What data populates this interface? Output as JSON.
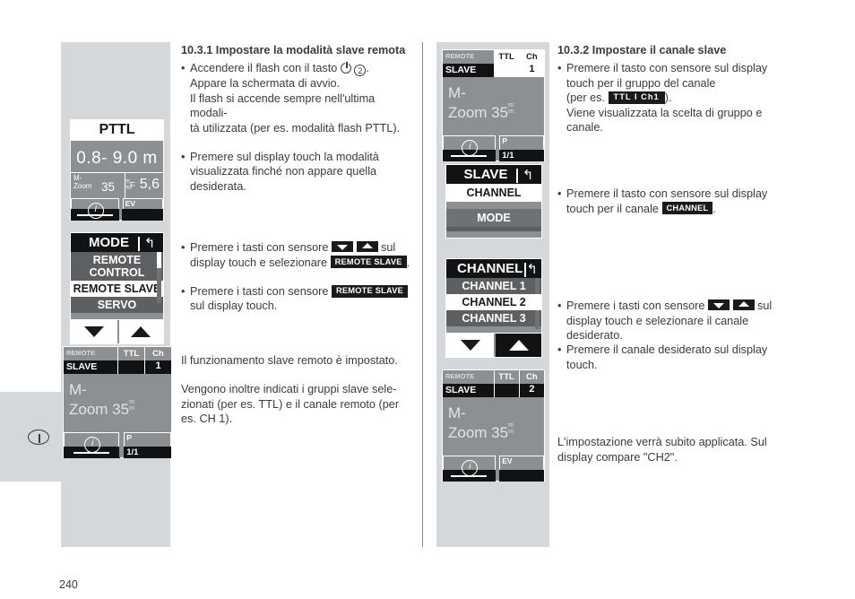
{
  "page": {
    "number": "240",
    "margin_icon": "info-oval-icon"
  },
  "left_column": {
    "heading": "10.3.1 Impostare la modalità slave remota",
    "bullets": [
      {
        "lines": [
          "Accendere il flash con il tasto  [power]  (2).",
          "Appare la schermata di avvio.",
          "Il flash si accende sempre nell'ultima modali-",
          "tà utilizzata (per es. modalità flash PTTL)."
        ]
      },
      {
        "lines": [
          "Premere sul display touch la modalità",
          "visualizzata finché non appare quella",
          "desiderata."
        ]
      },
      {
        "lines": [
          "Premere i tasti con sensore [down] [up] sul",
          "display touch e selezionare [REMOTE SLAVE] ."
        ]
      },
      {
        "lines": [
          "Premere i tasti con sensore [REMOTE SLAVE]",
          "sul display touch."
        ]
      }
    ],
    "paragraphs": [
      "Il funzionamento slave remoto è impostato.",
      "Vengono inoltre indicati i gruppi slave sele-",
      "zionati (per es. TTL) e il canale remoto (per",
      "es. CH 1)."
    ],
    "b1_l1a": "Accendere il flash con il tasto",
    "b1_l1b": ".",
    "b1_l2": "Appare la schermata di avvio.",
    "b1_l3": "Il flash si accende sempre nell'ultima modali-",
    "b1_l4": "tà utilizzata (per es. modalità flash PTTL).",
    "b2_l1": "Premere sul display touch la modalità",
    "b2_l2": "visualizzata finché non appare quella",
    "b2_l3": "desiderata.",
    "b3_l1a": "Premere i tasti con sensore",
    "b3_l1b": "sul",
    "b3_l2a": "display touch e selezionare",
    "b3_l2b": ".",
    "b4_l1a": "Premere i tasti con sensore",
    "b4_l2": "sul display touch.",
    "p1": "Il funzionamento slave remoto è impostato.",
    "p2_l1": "Vengono inoltre indicati i gruppi slave sele-",
    "p2_l2": "zionati (per es. TTL) e il canale remoto (per",
    "p2_l3": "es. CH 1).",
    "badge_remote_slave": "REMOTE SLAVE",
    "power_number": "2"
  },
  "right_column": {
    "heading": "10.3.2 Impostare il canale slave",
    "b1_l1": "Premere il tasto con sensore sul display",
    "b1_l2": "touch per il gruppo del canale",
    "b1_l3a": "(per es.",
    "b1_l3b": ").",
    "b1_l4": "Viene visualizzata la scelta di gruppo e",
    "b1_l5": "canale.",
    "b2_l1": "Premere il tasto con sensore sul display",
    "b2_l2a": "touch per il canale",
    "b2_l2b": ".",
    "b3_l1a": "Premere i tasti con sensore",
    "b3_l1b": "sul",
    "b3_l2": "display touch e selezionare il canale",
    "b3_l3": "desiderato.",
    "b4_l1": "Premere il canale desiderato sul display",
    "b4_l2": "touch.",
    "p1_l1": "L'impostazione verrà subito applicata. Sul",
    "p1_l2": "display compare \"CH2\".",
    "badge_ttl_ch1": "TTL  I  Ch1",
    "badge_channel": "CHANNEL"
  },
  "displays": {
    "pttl": {
      "title": "PTTL",
      "distance": "0.8- 9.0 m",
      "zoom_label": "M-\nZoom",
      "zoom_label_1": "M-",
      "zoom_label_2": "Zoom",
      "zoom_value": "35",
      "zoom_unit": "mm",
      "aperture_prefix": "F",
      "aperture_value": "5,6",
      "footer_info": "i",
      "footer_ev": "EV"
    },
    "mode_menu": {
      "title": "MODE",
      "back_icon": "back-arrow-icon",
      "items": [
        "REMOTE CONTROL",
        "REMOTE SLAVE",
        "SERVO"
      ],
      "selected_index": 1,
      "arrow_down": "down-arrow-icon",
      "arrow_up": "up-arrow-icon"
    },
    "status_ch1": {
      "label_remote": "REMOTE",
      "label_slave": "SLAVE",
      "mode": "TTL",
      "ch_label": "Ch",
      "ch_value": "1",
      "body_line1": "M-",
      "body_line2": "Zoom 35",
      "body_unit": "mm",
      "footer_info": "i",
      "footer_p": "P",
      "footer_p_value": "1/1"
    },
    "status_ch1_top": {
      "label_remote": "REMOTE",
      "label_slave": "SLAVE",
      "mode": "TTL",
      "ch_label": "Ch",
      "ch_value": "1",
      "body_line1": "M-",
      "body_line2": "Zoom 35",
      "body_unit": "mm",
      "footer_info": "i",
      "footer_p": "P",
      "footer_p_value": "1/1"
    },
    "slave_menu": {
      "title": "SLAVE",
      "back_icon": "back-arrow-icon",
      "items": [
        "CHANNEL",
        "MODE"
      ],
      "selected_index": 0
    },
    "channel_menu": {
      "title": "CHANNEL",
      "back_icon": "back-arrow-icon",
      "items": [
        "CHANNEL 1",
        "CHANNEL 2",
        "CHANNEL 3"
      ],
      "selected_index": 1,
      "arrow_down": "down-arrow-icon",
      "arrow_up": "up-arrow-icon"
    },
    "status_ch2": {
      "label_remote": "REMOTE",
      "label_slave": "SLAVE",
      "mode": "TTL",
      "ch_label": "Ch",
      "ch_value": "2",
      "body_line1": "M-",
      "body_line2": "Zoom 35",
      "body_unit": "mm",
      "footer_info": "i",
      "footer_ev": "EV"
    }
  }
}
